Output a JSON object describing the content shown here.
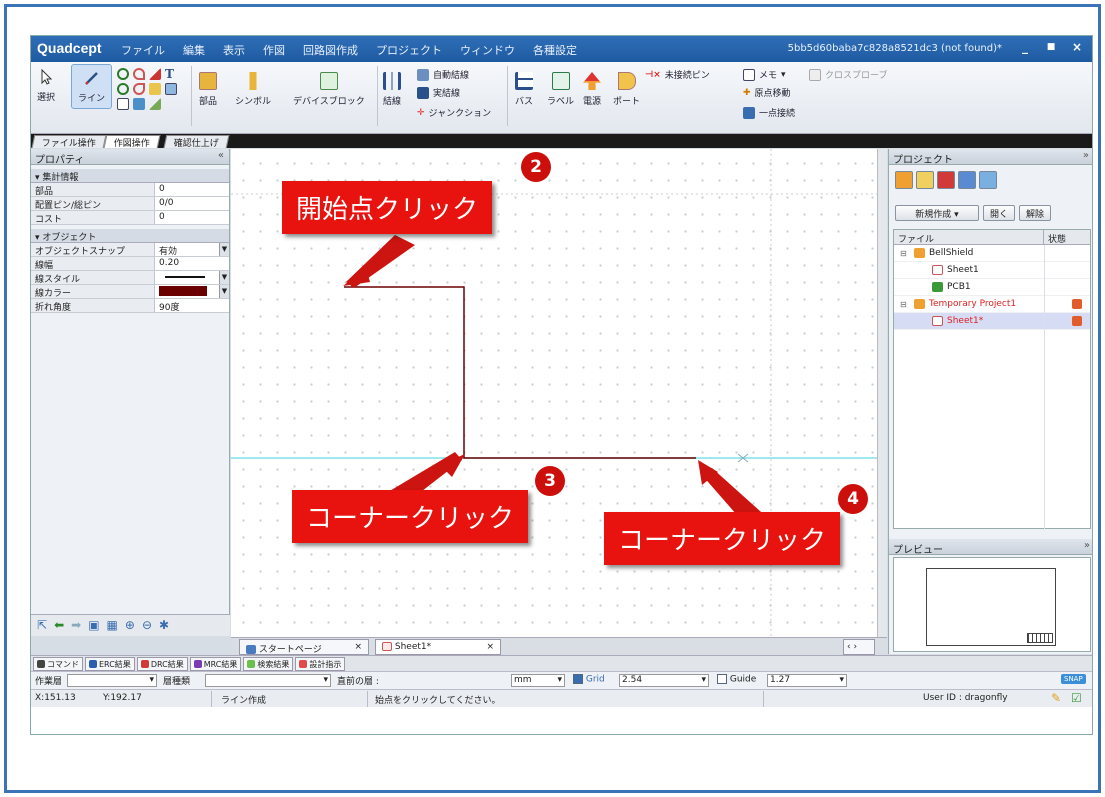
{
  "window": {
    "logo": "Quadcept",
    "title": "5bb5d60baba7c828a8521dc3 (not found)*",
    "menu": [
      "ファイル",
      "編集",
      "表示",
      "作図",
      "回路図作成",
      "プロジェクト",
      "ウィンドウ",
      "各種設定"
    ],
    "controls": [
      "_",
      "■",
      "×"
    ]
  },
  "ribbon": {
    "select": "選択",
    "line": "ライン",
    "part": "部品",
    "symbol": "シンボル",
    "device_block": "デバイスブロック",
    "wire": "結線",
    "auto_wire": "自動結線",
    "real_wire": "実結線",
    "junction": "ジャンクション",
    "bus": "バス",
    "label": "ラベル",
    "power": "電源",
    "port": "ポート",
    "unconnected_pin": "未接続ピン",
    "memo": "メモ",
    "origin_move": "原点移動",
    "single_point": "一点接続",
    "cross_probe": "クロスプローブ",
    "tabs": [
      "ファイル操作",
      "作図操作",
      "確認仕上げ"
    ]
  },
  "properties": {
    "title": "プロパティ",
    "summary_group": "集計情報",
    "summary_rows": [
      {
        "key": "部品",
        "value": "0"
      },
      {
        "key": "配置ピン/総ピン",
        "value": "0/0"
      },
      {
        "key": "コスト",
        "value": "0"
      }
    ],
    "object_group": "オブジェクト",
    "object_rows": [
      {
        "key": "オブジェクトスナップ",
        "value": "有効"
      },
      {
        "key": "線幅",
        "value": "0.20"
      },
      {
        "key": "線スタイル",
        "value": ""
      },
      {
        "key": "線カラー",
        "value": ""
      },
      {
        "key": "折れ角度",
        "value": "90度"
      }
    ],
    "line_color": "#6b0000"
  },
  "project": {
    "title": "プロジェクト",
    "new_button": "新規作成",
    "open_button": "開く",
    "remove_button": "解除",
    "col_file": "ファイル",
    "col_status": "状態",
    "tree": [
      {
        "label": "BellShield",
        "kind": "project",
        "status": false,
        "indent": 0
      },
      {
        "label": "Sheet1",
        "kind": "sheet",
        "status": false,
        "indent": 1
      },
      {
        "label": "PCB1",
        "kind": "pcb",
        "status": false,
        "indent": 1
      },
      {
        "label": "Temporary Project1",
        "kind": "project-red",
        "status": true,
        "indent": 0
      },
      {
        "label": "Sheet1*",
        "kind": "sheet-selected",
        "status": true,
        "indent": 1
      }
    ],
    "preview_title": "プレビュー"
  },
  "doc_tabs": [
    "スタートページ",
    "Sheet1*"
  ],
  "output_tabs": [
    "コマンド",
    "ERC結果",
    "DRC結果",
    "MRC結果",
    "検索結果",
    "設計指示"
  ],
  "layer_bar": {
    "work_layer_label": "作業層",
    "layer_type_label": "層種類",
    "prev_layer_label": "直前の層 :",
    "unit": "mm",
    "grid_label": "Grid",
    "grid_value": "2.54",
    "guide_label": "Guide",
    "guide_value": "1.27",
    "snap_label": "SNAP"
  },
  "status_bar": {
    "x": "X:151.13",
    "y": "Y:192.17",
    "mode": "ライン作成",
    "hint": "始点をクリックしてください。",
    "user": "User ID : dragonfly"
  },
  "callouts": [
    {
      "number": "2",
      "text": "開始点クリック"
    },
    {
      "number": "3",
      "text": "コーナークリック"
    },
    {
      "number": "4",
      "text": "コーナークリック"
    }
  ],
  "colors": {
    "accent": "#1e5aa0",
    "callout": "#e8120e",
    "wire": "#6b0000",
    "guide_line": "#7ee0e8"
  }
}
